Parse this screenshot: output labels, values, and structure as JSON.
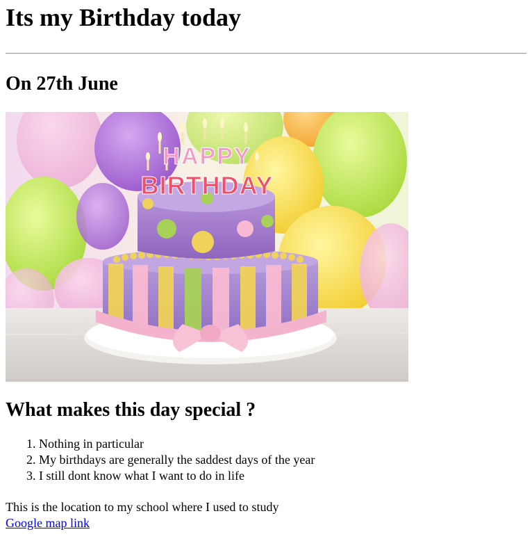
{
  "page": {
    "title": "Its my Birthday today",
    "date_heading": "On 27th June",
    "image": {
      "candle_letters_top": "HAPPY",
      "candle_letters_bottom": "BIRTHDAY"
    },
    "special_heading": "What makes this day special ?",
    "reasons": [
      "Nothing in particular",
      "My birthdays are generally the saddest days of the year",
      "I still dont know what I want to do in life"
    ],
    "location_text": "This is the location to my school where I used to study",
    "map_link_label": "Google map link"
  },
  "colors": {
    "text": "#000000",
    "link": "#0000ee",
    "rule": "#9a9a9a"
  }
}
